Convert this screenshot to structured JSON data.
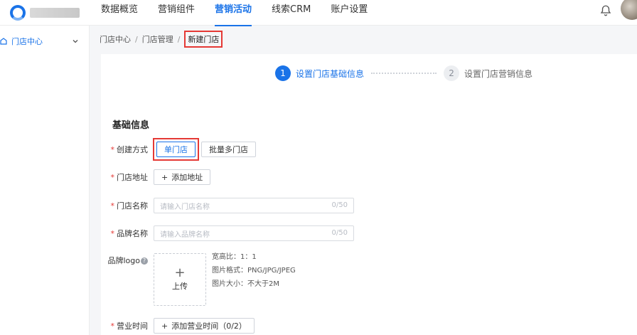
{
  "nav": {
    "items": [
      {
        "label": "数据概览"
      },
      {
        "label": "营销组件"
      },
      {
        "label": "营销活动"
      },
      {
        "label": "线索CRM"
      },
      {
        "label": "账户设置"
      }
    ],
    "active_index": 2
  },
  "sidebar": {
    "items": [
      {
        "label": "门店中心"
      }
    ]
  },
  "breadcrumb": {
    "items": [
      "门店中心",
      "门店管理"
    ],
    "separator": "/",
    "current": "新建门店"
  },
  "steps": [
    {
      "number": "1",
      "label": "设置门店基础信息",
      "state": "active"
    },
    {
      "number": "2",
      "label": "设置门店营销信息",
      "state": "todo"
    }
  ],
  "form": {
    "section_title": "基础信息",
    "required_mark": "*",
    "create_mode": {
      "label": "创建方式",
      "options": [
        "单门店",
        "批量多门店"
      ],
      "selected": "单门店"
    },
    "address": {
      "label": "门店地址",
      "button": "添加地址"
    },
    "store_name": {
      "label": "门店名称",
      "placeholder": "请输入门店名称",
      "count": "0/50"
    },
    "brand_name": {
      "label": "品牌名称",
      "placeholder": "请输入品牌名称",
      "count": "0/50"
    },
    "logo": {
      "label": "品牌logo",
      "help": "?",
      "upload_plus": "+",
      "upload_label": "上传",
      "hints": [
        "宽高比：1：1",
        "图片格式：PNG/JPG/JPEG",
        "图片大小：不大于2M"
      ]
    },
    "hours": {
      "label": "营业时间",
      "button": "添加营业时间（0/2）"
    }
  },
  "colors": {
    "accent": "#1a73e8",
    "highlight": "#e53935"
  }
}
